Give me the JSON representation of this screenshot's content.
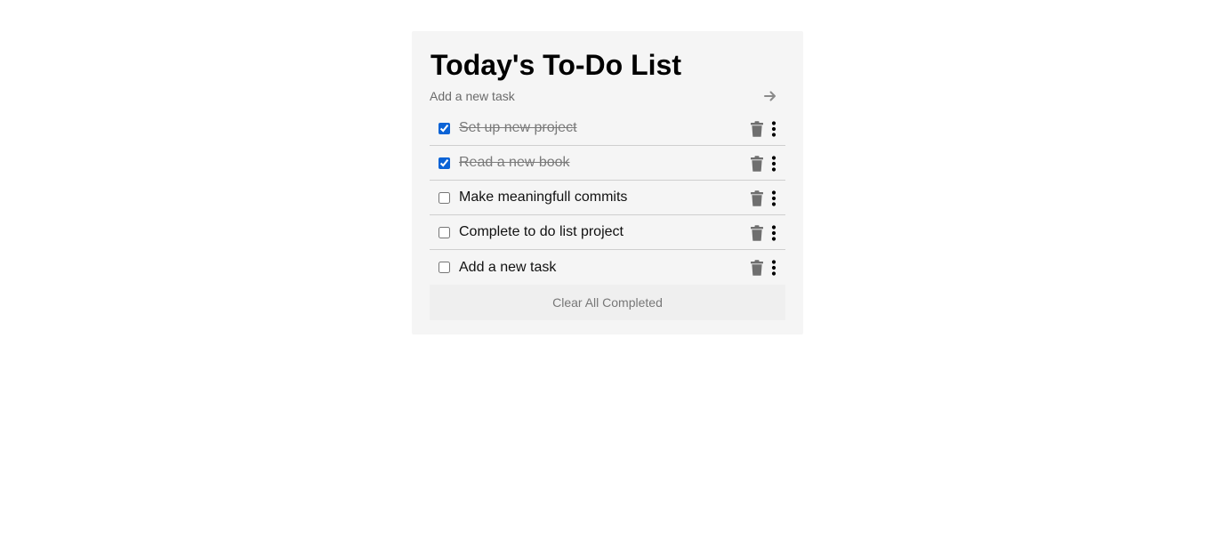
{
  "app": {
    "title": "Today's To-Do List"
  },
  "add_task": {
    "placeholder": "Add a new task",
    "submit_icon": "arrow-right-icon"
  },
  "tasks": [
    {
      "label": "Set up new project",
      "completed": true
    },
    {
      "label": "Read a new book",
      "completed": true
    },
    {
      "label": "Make meaningfull commits",
      "completed": false
    },
    {
      "label": "Complete to do list project",
      "completed": false
    },
    {
      "label": "Add a new task",
      "completed": false
    }
  ],
  "item_icons": {
    "delete": "trash-icon",
    "more": "more-vertical-icon"
  },
  "footer": {
    "clear_label": "Clear All Completed"
  },
  "colors": {
    "card_background": "#f5f5f5",
    "checkbox_accent": "#0b63d6",
    "completed_text": "#7a7a7a",
    "icon_gray": "#6f6f6f"
  }
}
